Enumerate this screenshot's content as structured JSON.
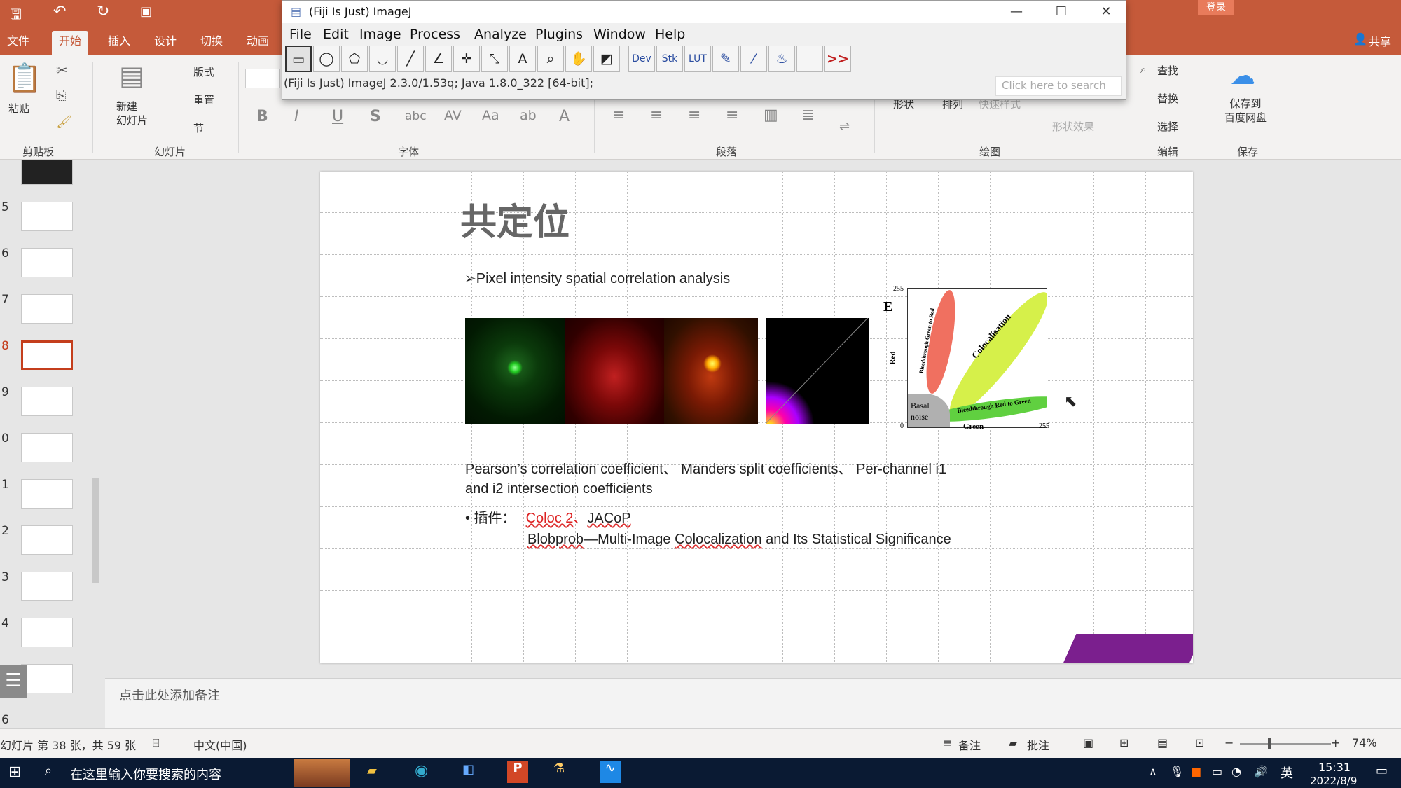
{
  "ppt": {
    "tabs": [
      "文件",
      "开始",
      "插入",
      "设计",
      "切换",
      "动画"
    ],
    "active_tab": "开始",
    "login": "登录",
    "share": "共享",
    "ribbon": {
      "paste": "粘贴",
      "new_slide": "新建\n幻灯片",
      "layout": "版式",
      "reset": "重置",
      "section": "节",
      "find": "查找",
      "replace": "替换",
      "select": "选择",
      "shape": "形状",
      "arrange": "排列",
      "quick_style": "快速样式",
      "shape_effect": "形状效果",
      "save_baidu": "保存到\n百度网盘",
      "groups": {
        "clipboard": "剪贴板",
        "slides": "幻灯片",
        "font": "字体",
        "paragraph": "段落",
        "drawing": "绘图",
        "editing": "编辑",
        "save": "保存"
      }
    }
  },
  "imagej": {
    "title": "(Fiji Is Just) ImageJ",
    "menus": [
      "File",
      "Edit",
      "Image",
      "Process",
      "Analyze",
      "Plugins",
      "Window",
      "Help"
    ],
    "tools": [
      "▭",
      "◯",
      "⬠",
      "◡",
      "╱",
      "∠",
      "✛",
      "⤡",
      "A",
      "⌕",
      "✋",
      "◩",
      "Dev",
      "Stk",
      "LUT",
      "✎",
      "⁄",
      "♨",
      "",
      ">>"
    ],
    "status": "(Fiji Is Just) ImageJ 2.3.0/1.53q; Java 1.8.0_322 [64-bit];",
    "search_placeholder": "Click here to search"
  },
  "thumbnails": {
    "numbers": [
      "5",
      "6",
      "7",
      "8",
      "9",
      "0",
      "1",
      "2",
      "3",
      "4",
      "6"
    ],
    "selected": "8"
  },
  "slide": {
    "title": "共定位",
    "bullet": "➢Pixel intensity spatial correlation analysis",
    "line1": "Pearson’s correlation coefficient、 Manders split coefficients、 Per-channel i1",
    "line2": "and i2 intersection coefficients",
    "plugin_prefix": "• 插件：",
    "plugin1": "Coloc 2",
    "plugin_sep": "、",
    "plugin2": "JACoP",
    "line4_a": "Blobprob",
    "line4_b": "—Multi-Image ",
    "line4_c": "Colocalization",
    "line4_d": " and Its Statistical Significance",
    "chart": {
      "panel": "E",
      "xlabel": "Green",
      "ylabel": "Red",
      "max": "255",
      "zero": "0",
      "basal": "Basal",
      "noise": "noise",
      "colocalisation": "Colocalisation",
      "bleed_red_green": "Bleedthrough Red to Green",
      "bleed_green_red": "Bleedthrough Green to Red"
    }
  },
  "notes": "点击此处添加备注",
  "status": {
    "slide_info": "幻灯片 第 38 张，共 59 张",
    "language": "中文(中国)",
    "notes_btn": "备注",
    "comments_btn": "批注",
    "zoom": "74%"
  },
  "taskbar": {
    "search": "在这里输入你要搜索的内容",
    "ime": "英",
    "time": "15:31",
    "date": "2022/8/9"
  }
}
